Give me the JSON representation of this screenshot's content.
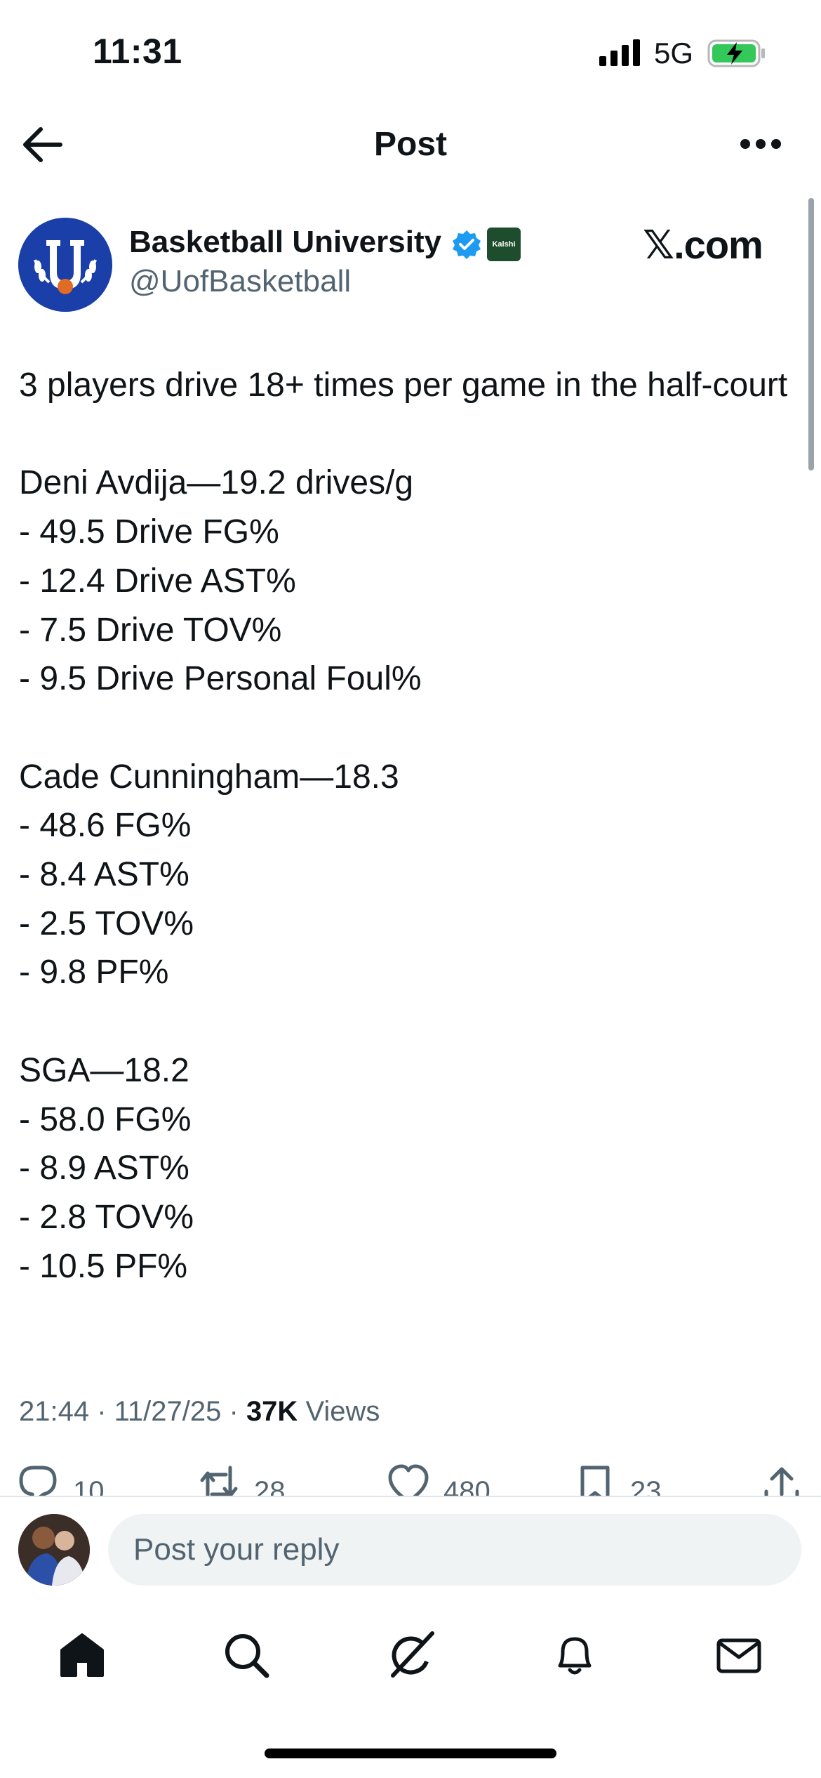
{
  "status_bar": {
    "time": "11:31",
    "network": "5G"
  },
  "header": {
    "title": "Post"
  },
  "author": {
    "name": "Basketball University",
    "handle": "@UofBasketball",
    "affiliate_badge": "Kalshi",
    "watermark": "𝕏.com"
  },
  "post": {
    "text": "3 players drive 18+ times per game in the half-court\n\nDeni Avdija—19.2 drives/g\n- 49.5 Drive FG%\n- 12.4 Drive AST%\n- 7.5 Drive TOV%\n- 9.5 Drive Personal Foul%\n\nCade Cunningham—18.3\n- 48.6 FG%\n- 8.4 AST%\n- 2.5 TOV%\n- 9.8 PF%\n\nSGA—18.2\n- 58.0 FG%\n- 8.9 AST%\n- 2.8 TOV%\n- 10.5 PF%",
    "time": "21:44",
    "date": "11/27/25",
    "views_count": "37K",
    "views_label": "Views"
  },
  "actions": {
    "replies": "10",
    "reposts": "28",
    "likes": "480",
    "bookmarks": "23"
  },
  "reply": {
    "placeholder": "Post your reply"
  },
  "colors": {
    "text": "#0f1419",
    "secondary": "#536471",
    "verified": "#1d9bf0",
    "battery": "#34c759"
  },
  "icons": [
    "back-arrow-icon",
    "more-icon",
    "verified-icon",
    "reply-icon",
    "repost-icon",
    "like-icon",
    "bookmark-icon",
    "share-icon",
    "home-icon",
    "search-icon",
    "grok-icon",
    "notifications-icon",
    "messages-icon"
  ]
}
